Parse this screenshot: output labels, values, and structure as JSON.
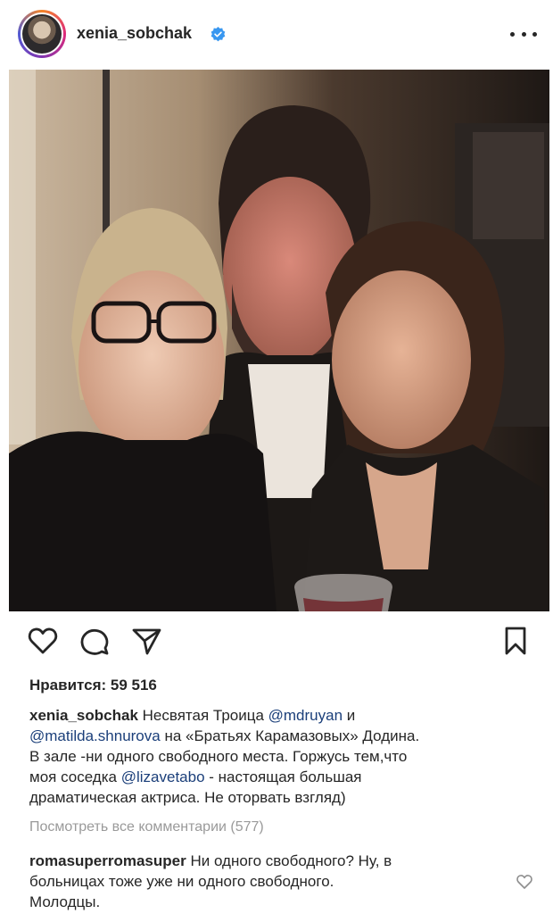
{
  "header": {
    "username": "xenia_sobchak"
  },
  "post": {
    "likes": "Нравится: 59 516",
    "caption": {
      "author": "xenia_sobchak",
      "line1_text": " Несвятая Троица ",
      "line1_mention": "@mdruyan",
      "line1_tail": " и",
      "line2_mention": "@matilda.shnurova",
      "line2_text": " на «Братьях Карамазовых» Додина.",
      "line3": "В зале -ни одного свободного места. Горжусь тем,что",
      "line4_text": "моя соседка  ",
      "line4_mention": "@lizavetabo",
      "line4_tail": " - настоящая большая",
      "line5": "драматическая актриса. Не оторвать взгляд)"
    },
    "view_comments": "Посмотреть все комментарии (577)",
    "comment": {
      "author": "romasuperromasuper",
      "line1_text": " Ни одного свободного? Ну, в",
      "line2": "больницах тоже уже ни одного свободного.",
      "line3": "Молодцы."
    }
  },
  "colors": {
    "text": "#262626",
    "mention": "#1b3f7a",
    "muted": "#9a9a9a",
    "verified": "#3897f0"
  },
  "icons": {
    "like": "heart-icon",
    "comment": "comment-bubble-icon",
    "share": "paper-plane-icon",
    "save": "bookmark-icon",
    "more": "more-dots-icon",
    "verified": "verified-badge-icon"
  }
}
